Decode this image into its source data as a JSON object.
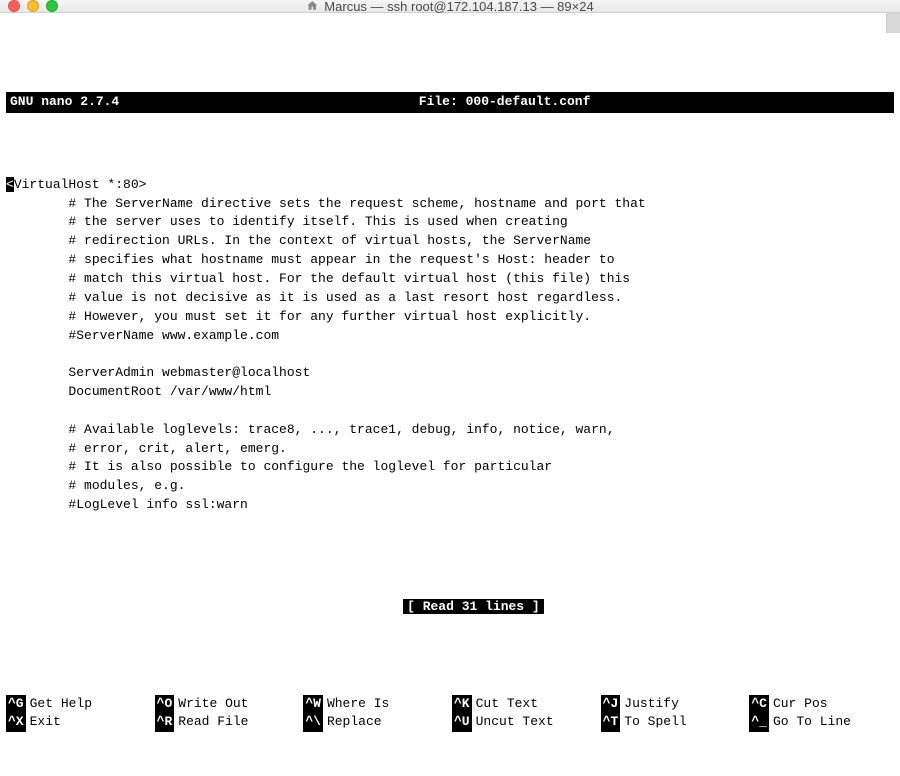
{
  "window": {
    "title": "Marcus — ssh root@172.104.187.13 — 89×24"
  },
  "nano": {
    "app": "GNU nano 2.7.4",
    "file_label": "File: 000-default.conf",
    "status": "[ Read 31 lines ]"
  },
  "file": {
    "lines": [
      "<VirtualHost *:80>",
      "        # The ServerName directive sets the request scheme, hostname and port that",
      "        # the server uses to identify itself. This is used when creating",
      "        # redirection URLs. In the context of virtual hosts, the ServerName",
      "        # specifies what hostname must appear in the request's Host: header to",
      "        # match this virtual host. For the default virtual host (this file) this",
      "        # value is not decisive as it is used as a last resort host regardless.",
      "        # However, you must set it for any further virtual host explicitly.",
      "        #ServerName www.example.com",
      "",
      "        ServerAdmin webmaster@localhost",
      "        DocumentRoot /var/www/html",
      "",
      "        # Available loglevels: trace8, ..., trace1, debug, info, notice, warn,",
      "        # error, crit, alert, emerg.",
      "        # It is also possible to configure the loglevel for particular",
      "        # modules, e.g.",
      "        #LogLevel info ssl:warn"
    ],
    "first_line_rest": "VirtualHost *:80>"
  },
  "shortcuts": [
    {
      "key": "^G",
      "label": "Get Help"
    },
    {
      "key": "^O",
      "label": "Write Out"
    },
    {
      "key": "^W",
      "label": "Where Is"
    },
    {
      "key": "^K",
      "label": "Cut Text"
    },
    {
      "key": "^J",
      "label": "Justify"
    },
    {
      "key": "^C",
      "label": "Cur Pos"
    },
    {
      "key": "^X",
      "label": "Exit"
    },
    {
      "key": "^R",
      "label": "Read File"
    },
    {
      "key": "^\\",
      "label": "Replace"
    },
    {
      "key": "^U",
      "label": "Uncut Text"
    },
    {
      "key": "^T",
      "label": "To Spell"
    },
    {
      "key": "^_",
      "label": "Go To Line"
    }
  ]
}
